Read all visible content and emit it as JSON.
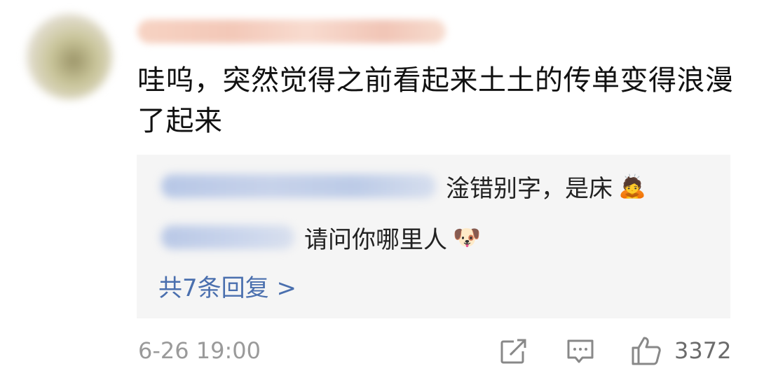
{
  "comment": {
    "text": "哇呜，突然觉得之前看起来土土的传单变得浪漫了起来"
  },
  "replies": [
    {
      "text": "淦错别字，是床",
      "emoji": "🙇"
    },
    {
      "text": "请问你哪里人",
      "emoji": "🐶"
    }
  ],
  "more_replies_label": "共7条回复 >",
  "footer": {
    "timestamp": "6-26 19:00",
    "like_count": "3372"
  },
  "colors": {
    "link_blue": "#4a6fae",
    "reply_bg": "#f5f5f5",
    "meta_gray": "#9a9a9a"
  }
}
